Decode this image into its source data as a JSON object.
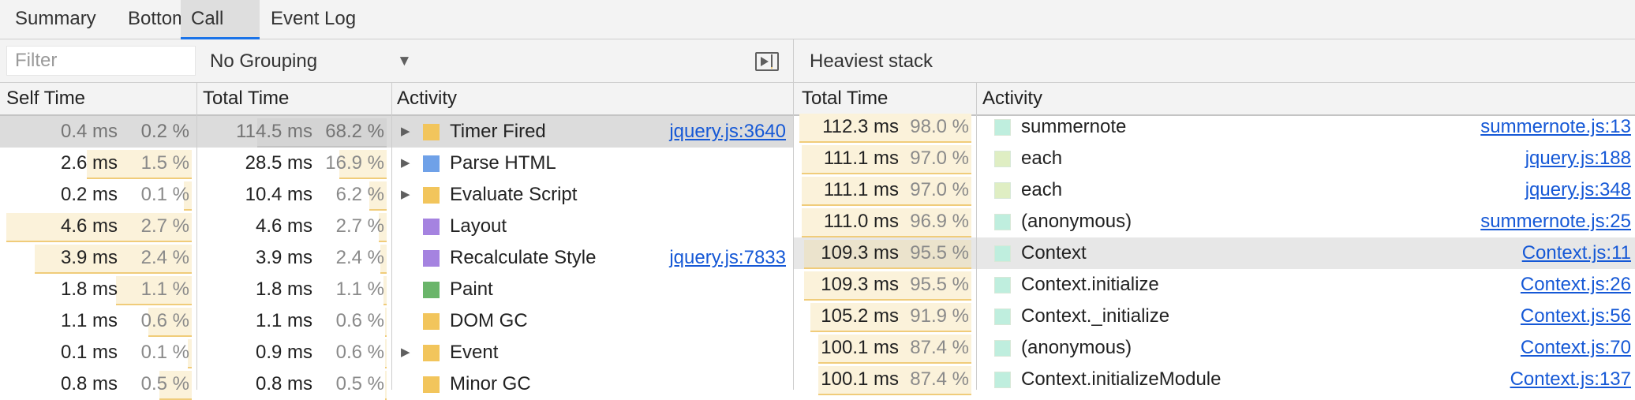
{
  "tabs": [
    {
      "label": "Summary",
      "active": false
    },
    {
      "label": "Bottom-Up",
      "active": false
    },
    {
      "label": "Call Tree",
      "active": true
    },
    {
      "label": "Event Log",
      "active": false
    }
  ],
  "toolbar": {
    "filter_placeholder": "Filter",
    "grouping_label": "No Grouping",
    "dropdown_icon": "triangle-down",
    "sidebar_toggle_icon": "show-sidebar"
  },
  "call_tree": {
    "headers": {
      "self_time": "Self Time",
      "total_time": "Total Time",
      "activity": "Activity"
    },
    "rows": [
      {
        "self_ms": "0.4 ms",
        "self_pct": "0.2 %",
        "self_frac": 0.002,
        "total_ms": "114.5 ms",
        "total_pct": "68.2 %",
        "total_frac": 0.682,
        "expandable": true,
        "name": "Timer Fired",
        "color": "#f2c55c",
        "link": "jquery.js:3640",
        "selected": true
      },
      {
        "self_ms": "2.6 ms",
        "self_pct": "1.5 %",
        "self_frac": 0.553,
        "total_ms": "28.5 ms",
        "total_pct": "16.9 %",
        "total_frac": 0.248,
        "expandable": true,
        "name": "Parse HTML",
        "color": "#6fa1e8",
        "link": ""
      },
      {
        "self_ms": "0.2 ms",
        "self_pct": "0.1 %",
        "self_frac": 0.04,
        "total_ms": "10.4 ms",
        "total_pct": "6.2 %",
        "total_frac": 0.09,
        "expandable": true,
        "name": "Evaluate Script",
        "color": "#f2c55c",
        "link": ""
      },
      {
        "self_ms": "4.6 ms",
        "self_pct": "2.7 %",
        "self_frac": 0.98,
        "total_ms": "4.6 ms",
        "total_pct": "2.7 %",
        "total_frac": 0.04,
        "expandable": false,
        "name": "Layout",
        "color": "#a583e0",
        "link": ""
      },
      {
        "self_ms": "3.9 ms",
        "self_pct": "2.4 %",
        "self_frac": 0.83,
        "total_ms": "3.9 ms",
        "total_pct": "2.4 %",
        "total_frac": 0.035,
        "expandable": false,
        "name": "Recalculate Style",
        "color": "#a583e0",
        "link": "jquery.js:7833"
      },
      {
        "self_ms": "1.8 ms",
        "self_pct": "1.1 %",
        "self_frac": 0.4,
        "total_ms": "1.8 ms",
        "total_pct": "1.1 %",
        "total_frac": 0.016,
        "expandable": false,
        "name": "Paint",
        "color": "#6ab56a",
        "link": ""
      },
      {
        "self_ms": "1.1 ms",
        "self_pct": "0.6 %",
        "self_frac": 0.23,
        "total_ms": "1.1 ms",
        "total_pct": "0.6 %",
        "total_frac": 0.009,
        "expandable": false,
        "name": "DOM GC",
        "color": "#f2c55c",
        "link": ""
      },
      {
        "self_ms": "0.1 ms",
        "self_pct": "0.1 %",
        "self_frac": 0.02,
        "total_ms": "0.9 ms",
        "total_pct": "0.6 %",
        "total_frac": 0.008,
        "expandable": true,
        "name": "Event",
        "color": "#f2c55c",
        "link": ""
      },
      {
        "self_ms": "0.8 ms",
        "self_pct": "0.5 %",
        "self_frac": 0.17,
        "total_ms": "0.8 ms",
        "total_pct": "0.5 %",
        "total_frac": 0.007,
        "expandable": false,
        "name": "Minor GC",
        "color": "#f2c55c",
        "link": ""
      }
    ]
  },
  "heaviest_stack": {
    "title": "Heaviest stack",
    "headers": {
      "total_time": "Total Time",
      "activity": "Activity"
    },
    "rows": [
      {
        "ms": "112.3 ms",
        "pct": "98.0 %",
        "frac": 0.98,
        "name": "summernote",
        "color": "#bfeede",
        "link": "summernote.js:13"
      },
      {
        "ms": "111.1 ms",
        "pct": "97.0 %",
        "frac": 0.97,
        "name": "each",
        "color": "#dfeec3",
        "link": "jquery.js:188"
      },
      {
        "ms": "111.1 ms",
        "pct": "97.0 %",
        "frac": 0.97,
        "name": "each",
        "color": "#dfeec3",
        "link": "jquery.js:348"
      },
      {
        "ms": "111.0 ms",
        "pct": "96.9 %",
        "frac": 0.969,
        "name": "(anonymous)",
        "color": "#bfeede",
        "link": "summernote.js:25"
      },
      {
        "ms": "109.3 ms",
        "pct": "95.5 %",
        "frac": 0.955,
        "name": "Context",
        "color": "#bfeede",
        "link": "Context.js:11",
        "hovered": true
      },
      {
        "ms": "109.3 ms",
        "pct": "95.5 %",
        "frac": 0.955,
        "name": "Context.initialize",
        "color": "#bfeede",
        "link": "Context.js:26"
      },
      {
        "ms": "105.2 ms",
        "pct": "91.9 %",
        "frac": 0.919,
        "name": "Context._initialize",
        "color": "#bfeede",
        "link": "Context.js:56"
      },
      {
        "ms": "100.1 ms",
        "pct": "87.4 %",
        "frac": 0.874,
        "name": "(anonymous)",
        "color": "#bfeede",
        "link": "Context.js:70"
      },
      {
        "ms": "100.1 ms",
        "pct": "87.4 %",
        "frac": 0.874,
        "name": "Context.initializeModule",
        "color": "#bfeede",
        "link": "Context.js:137"
      }
    ]
  }
}
